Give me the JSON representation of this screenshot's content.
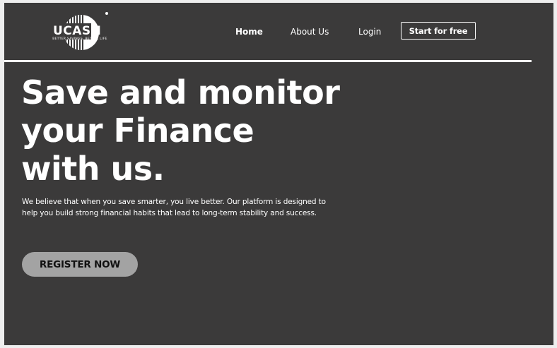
{
  "brand": {
    "name": "UCASH",
    "tagline": "BETTER SAVINGS, BETTER LIFE"
  },
  "nav": {
    "items": [
      {
        "label": "Home",
        "active": true
      },
      {
        "label": "About Us",
        "active": false
      },
      {
        "label": "Login",
        "active": false
      }
    ],
    "cta_label": "Start for free"
  },
  "hero": {
    "title_line1": "Save and monitor",
    "title_line2": "your Finance",
    "title_line3": "with us.",
    "description": "We believe that when you save smarter, you live better. Our platform is designed to help you build strong financial habits that lead to long-term stability and success.",
    "register_label": "REGISTER NOW"
  },
  "colors": {
    "background": "#3b3a3a",
    "text": "#ffffff",
    "button": "#a3a3a3"
  }
}
